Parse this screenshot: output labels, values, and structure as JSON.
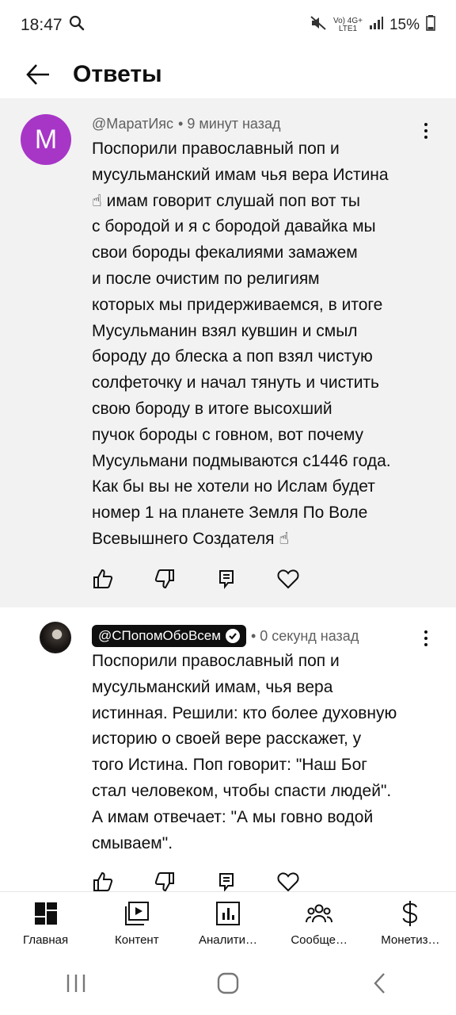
{
  "status": {
    "time": "18:47",
    "battery": "15%",
    "net_top": "Vo) 4G+",
    "net_bottom": "LTE1"
  },
  "header": {
    "title": "Ответы"
  },
  "comments": [
    {
      "avatar_letter": "M",
      "author": "@МаратИяс",
      "time": "• 9 минут назад",
      "text": "Поспорили православный поп и\nмусульманский имам чья вера Истина\n☝ имам говорит  слушай поп вот ты\nс бородой и я с бородой давайка мы\nсвои бороды фекалиями замажем\nи после очистим по религиям\nкоторых мы придерживаемся, в итоге\nМусульманин взял кувшин и смыл\nбороду до блеска а поп взял чистую\nсолфеточку и начал тянуть и чистить\nсвою бороду в итоге высохший\nпучок бороды с говном, вот почему\nМусульмани подмываются с1446 года.\nКак бы вы не хотели но Ислам будет\nномер 1 на планете Земля По Воле\nВсевышнего Создателя ☝"
    },
    {
      "author": "@СПопомОбоВсем",
      "time": "• 0 секунд назад",
      "text": "Поспорили православный поп и\nмусульманский имам, чья вера\nистинная. Решили: кто более духовную\nисторию о своей вере расскажет, у\nтого Истина. Поп говорит: \"Наш Бог\nстал человеком, чтобы спасти людей\".\nА имам отвечает: \"А мы говно водой\nсмываем\"."
    }
  ],
  "bottom_nav": [
    {
      "label": "Главная",
      "icon": "dashboard-icon"
    },
    {
      "label": "Контент",
      "icon": "video-library-icon"
    },
    {
      "label": "Аналити…",
      "icon": "analytics-icon"
    },
    {
      "label": "Сообще…",
      "icon": "community-icon"
    },
    {
      "label": "Монетиз…",
      "icon": "dollar-icon"
    }
  ],
  "colors": {
    "avatar_bg": "#a736c7",
    "comment_bg": "#f2f2f2",
    "handle_bg": "#0f0f0f"
  }
}
